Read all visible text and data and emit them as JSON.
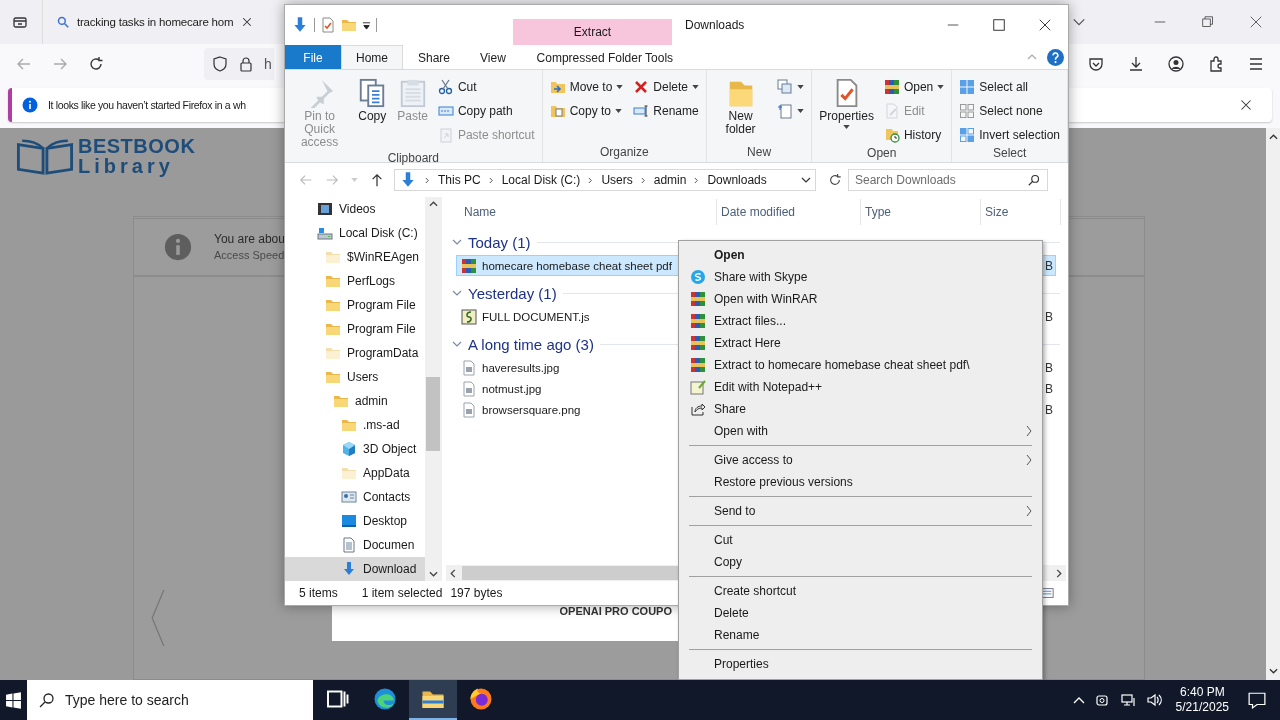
{
  "browser": {
    "tab_title": "tracking tasks in homecare hom",
    "address": "h",
    "notification": "It looks like you haven’t started Firefox in a wh"
  },
  "page": {
    "logo_title": "BESTBOOK",
    "logo_subtitle": "Library",
    "notice_title": "You are abou",
    "notice_subtitle": "Access Speed",
    "coupon": "OPENAI PRO COUPO"
  },
  "explorer": {
    "title": "Downloads",
    "context_label": "Extract",
    "tabs": [
      {
        "label": "File",
        "kind": "file",
        "selected": false
      },
      {
        "label": "Home",
        "kind": "plain",
        "selected": true
      },
      {
        "label": "Share",
        "kind": "plain",
        "selected": false
      },
      {
        "label": "View",
        "kind": "plain",
        "selected": false
      },
      {
        "label": "Compressed Folder Tools",
        "kind": "contextual",
        "selected": false
      }
    ],
    "ribbon": [
      {
        "label": "Clipboard",
        "columns": [
          [
            {
              "label": "Pin to Quick access",
              "kind": "pin",
              "large": true,
              "disabled": true,
              "dropdown": false
            }
          ],
          [
            {
              "label": "Copy",
              "kind": "copy",
              "large": true,
              "disabled": false,
              "dropdown": false
            }
          ],
          [
            {
              "label": "Paste",
              "kind": "paste",
              "large": true,
              "disabled": true,
              "dropdown": false
            }
          ],
          [
            {
              "label": "Cut",
              "kind": "cut",
              "large": false,
              "disabled": false,
              "dropdown": false
            },
            {
              "label": "Copy path",
              "kind": "copypath",
              "large": false,
              "disabled": false,
              "dropdown": false
            },
            {
              "label": "Paste shortcut",
              "kind": "pasteshortcut",
              "large": false,
              "disabled": true,
              "dropdown": false
            }
          ]
        ]
      },
      {
        "label": "Organize",
        "columns": [
          [
            {
              "label": "Move to",
              "kind": "moveto",
              "large": false,
              "disabled": false,
              "dropdown": true
            },
            {
              "label": "Copy to",
              "kind": "copyto",
              "large": false,
              "disabled": false,
              "dropdown": true
            }
          ],
          [
            {
              "label": "Delete",
              "kind": "delete",
              "large": false,
              "disabled": false,
              "dropdown": true
            },
            {
              "label": "Rename",
              "kind": "rename",
              "large": false,
              "disabled": false,
              "dropdown": false
            }
          ]
        ]
      },
      {
        "label": "New",
        "columns": [
          [
            {
              "label": "New folder",
              "kind": "newfolder",
              "large": true,
              "disabled": false,
              "dropdown": false
            }
          ],
          [
            {
              "kind": "newitem",
              "large": false,
              "disabled": false,
              "dropdown": true
            },
            {
              "kind": "easyaccess",
              "large": false,
              "disabled": false,
              "dropdown": true
            }
          ]
        ]
      },
      {
        "label": "Open",
        "columns": [
          [
            {
              "label": "Properties",
              "kind": "properties",
              "large": true,
              "disabled": false,
              "dropdown": true
            }
          ],
          [
            {
              "label": "Open",
              "kind": "winrar",
              "large": false,
              "disabled": false,
              "dropdown": true
            },
            {
              "label": "Edit",
              "kind": "edit",
              "large": false,
              "disabled": true,
              "dropdown": false
            },
            {
              "label": "History",
              "kind": "history",
              "large": false,
              "disabled": false,
              "dropdown": false
            }
          ]
        ]
      },
      {
        "label": "Select",
        "columns": [
          [
            {
              "label": "Select all",
              "kind": "selectall",
              "large": false,
              "disabled": false,
              "dropdown": false
            },
            {
              "label": "Select none",
              "kind": "selectnone",
              "large": false,
              "disabled": false,
              "dropdown": false
            },
            {
              "label": "Invert selection",
              "kind": "invert",
              "large": false,
              "disabled": false,
              "dropdown": false
            }
          ]
        ]
      }
    ],
    "breadcrumb": [
      "This PC",
      "Local Disk (C:)",
      "Users",
      "admin",
      "Downloads"
    ],
    "search_placeholder": "Search Downloads",
    "nav": [
      {
        "label": "Videos",
        "kind": "videos",
        "selected": false
      },
      {
        "label": "Local Disk (C:)",
        "kind": "drive",
        "selected": false,
        "children": [
          {
            "label": "$WinREAgen",
            "kind": "hidden-folder",
            "selected": false
          },
          {
            "label": "PerfLogs",
            "kind": "folder",
            "selected": false
          },
          {
            "label": "Program File",
            "kind": "folder",
            "selected": false
          },
          {
            "label": "Program File",
            "kind": "folder",
            "selected": false
          },
          {
            "label": "ProgramData",
            "kind": "hidden-folder",
            "selected": false
          },
          {
            "label": "Users",
            "kind": "folder",
            "selected": false,
            "children": [
              {
                "label": "admin",
                "kind": "folder",
                "selected": false,
                "children": [
                  {
                    "label": ".ms-ad",
                    "kind": "folder",
                    "selected": false
                  },
                  {
                    "label": "3D Object",
                    "kind": "cube",
                    "selected": false
                  },
                  {
                    "label": "AppData",
                    "kind": "hidden-folder",
                    "selected": false
                  },
                  {
                    "label": "Contacts",
                    "kind": "contacts",
                    "selected": false
                  },
                  {
                    "label": "Desktop",
                    "kind": "desktop",
                    "selected": false
                  },
                  {
                    "label": "Documen",
                    "kind": "documents",
                    "selected": false
                  },
                  {
                    "label": "Download",
                    "kind": "downloads",
                    "selected": true
                  }
                ]
              }
            ]
          }
        ]
      }
    ],
    "columns": [
      "Name",
      "Date modified",
      "Type",
      "Size"
    ],
    "groups": [
      {
        "label": "Today (1)",
        "files": [
          {
            "name": "homecare homebase cheat sheet pdf",
            "kind": "archive",
            "selected": true,
            "size": "B"
          }
        ]
      },
      {
        "label": "Yesterday (1)",
        "files": [
          {
            "name": "FULL DOCUMENT.js",
            "kind": "script",
            "selected": false,
            "size": "B"
          }
        ]
      },
      {
        "label": "A long time ago (3)",
        "files": [
          {
            "name": "haveresults.jpg",
            "kind": "image",
            "selected": false,
            "size": "B"
          },
          {
            "name": "notmust.jpg",
            "kind": "image",
            "selected": false,
            "size": "B"
          },
          {
            "name": "browsersquare.png",
            "kind": "image",
            "selected": false,
            "size": "B"
          }
        ]
      }
    ],
    "status": {
      "count": "5 items",
      "selection": "1 item selected",
      "size": "197 bytes"
    }
  },
  "context_menu": {
    "sections": [
      [
        {
          "label": "Open",
          "kind": "none",
          "default": true,
          "submenu": false
        },
        {
          "label": "Share with Skype",
          "kind": "skype",
          "default": false,
          "submenu": false
        },
        {
          "label": "Open with WinRAR",
          "kind": "winrar",
          "default": false,
          "submenu": false
        },
        {
          "label": "Extract files...",
          "kind": "winrar",
          "default": false,
          "submenu": false
        },
        {
          "label": "Extract Here",
          "kind": "winrar",
          "default": false,
          "submenu": false
        },
        {
          "label": "Extract to homecare homebase cheat sheet pdf\\",
          "kind": "winrar",
          "default": false,
          "submenu": false
        },
        {
          "label": "Edit with Notepad++",
          "kind": "notepad",
          "default": false,
          "submenu": false
        },
        {
          "label": "Share",
          "kind": "share",
          "default": false,
          "submenu": false
        },
        {
          "label": "Open with",
          "kind": "none",
          "default": false,
          "submenu": true
        }
      ],
      [
        {
          "label": "Give access to",
          "kind": "none",
          "default": false,
          "submenu": true
        },
        {
          "label": "Restore previous versions",
          "kind": "none",
          "default": false,
          "submenu": false
        }
      ],
      [
        {
          "label": "Send to",
          "kind": "none",
          "default": false,
          "submenu": true
        }
      ],
      [
        {
          "label": "Cut",
          "kind": "none",
          "default": false,
          "submenu": false
        },
        {
          "label": "Copy",
          "kind": "none",
          "default": false,
          "submenu": false
        }
      ],
      [
        {
          "label": "Create shortcut",
          "kind": "none",
          "default": false,
          "submenu": false
        },
        {
          "label": "Delete",
          "kind": "none",
          "default": false,
          "submenu": false
        },
        {
          "label": "Rename",
          "kind": "none",
          "default": false,
          "submenu": false
        }
      ],
      [
        {
          "label": "Properties",
          "kind": "none",
          "default": false,
          "submenu": false
        }
      ]
    ]
  },
  "taskbar": {
    "search_placeholder": "Type here to search",
    "apps": [
      {
        "kind": "taskview",
        "active": false
      },
      {
        "kind": "edge",
        "active": false
      },
      {
        "kind": "explorer",
        "active": true
      },
      {
        "kind": "firefox",
        "active": false
      }
    ],
    "time": "6:40 PM",
    "date": "5/21/2025"
  }
}
